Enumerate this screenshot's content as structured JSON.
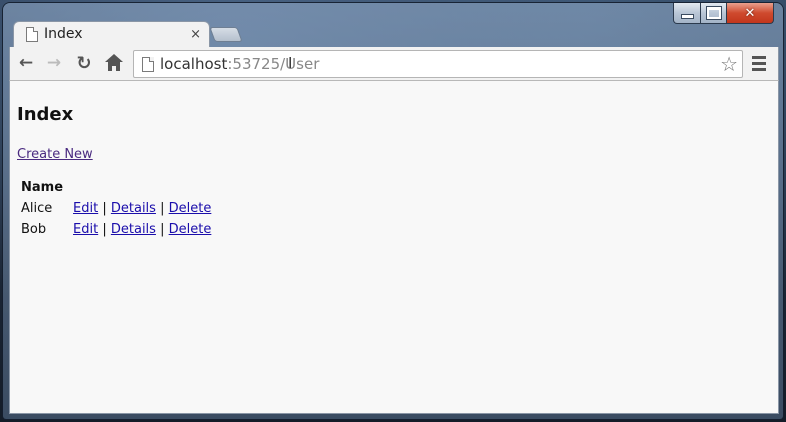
{
  "window": {
    "min_icon": "minimize-icon",
    "max_icon": "maximize-icon",
    "close_icon": "close-icon",
    "close_glyph": "✕"
  },
  "tab": {
    "title": "Index",
    "close_glyph": "×"
  },
  "toolbar": {
    "back_glyph": "←",
    "forward_glyph": "→",
    "reload_glyph": "↻",
    "star_glyph": "☆"
  },
  "address": {
    "host": "localhost",
    "path": ":53725/User",
    "caret": "I"
  },
  "page": {
    "title": "Index",
    "create_link": "Create New",
    "table": {
      "headers": [
        "Name"
      ],
      "rows": [
        {
          "name": "Alice",
          "edit": "Edit",
          "details": "Details",
          "delete": "Delete"
        },
        {
          "name": "Bob",
          "edit": "Edit",
          "details": "Details",
          "delete": "Delete"
        }
      ],
      "separator": "|"
    }
  },
  "colors": {
    "link": "#1a0dab",
    "visited_link": "#4a2a80",
    "close_button": "#c2361c"
  }
}
